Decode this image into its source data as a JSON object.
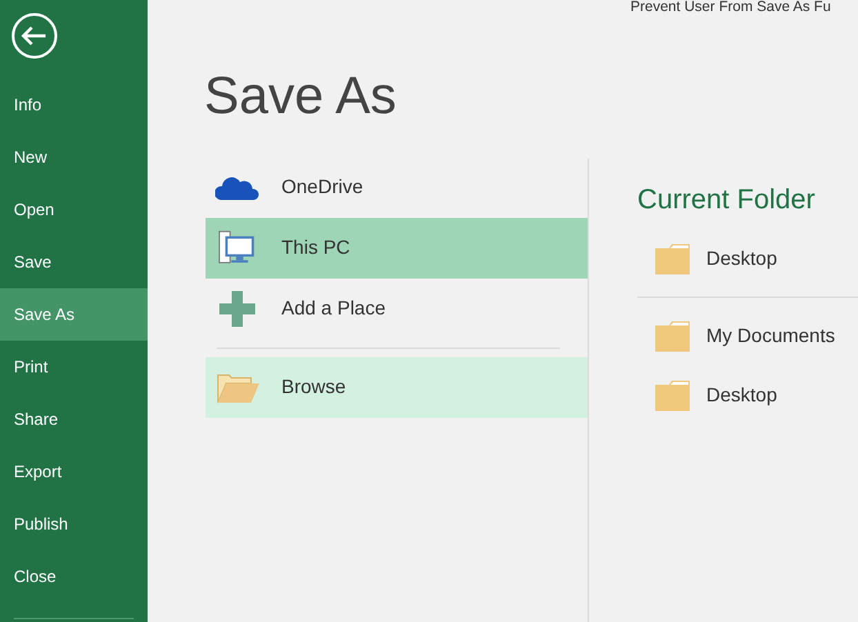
{
  "window": {
    "title": "Prevent User From Save As Fu"
  },
  "sidebar": {
    "items": [
      {
        "label": "Info",
        "selected": false
      },
      {
        "label": "New",
        "selected": false
      },
      {
        "label": "Open",
        "selected": false
      },
      {
        "label": "Save",
        "selected": false
      },
      {
        "label": "Save As",
        "selected": true
      },
      {
        "label": "Print",
        "selected": false
      },
      {
        "label": "Share",
        "selected": false
      },
      {
        "label": "Export",
        "selected": false
      },
      {
        "label": "Publish",
        "selected": false
      },
      {
        "label": "Close",
        "selected": false
      }
    ]
  },
  "heading": "Save As",
  "places": [
    {
      "kind": "cloud",
      "label": "OneDrive",
      "selected": false,
      "hovered": false
    },
    {
      "kind": "computer",
      "label": "This PC",
      "selected": true,
      "hovered": false
    },
    {
      "kind": "add",
      "label": "Add a Place",
      "selected": false,
      "hovered": false
    },
    {
      "kind": "folder",
      "label": "Browse",
      "selected": false,
      "hovered": true
    }
  ],
  "current_folder": {
    "title": "Current Folder",
    "folders": [
      {
        "label": "Desktop"
      }
    ]
  },
  "recent_folders": [
    {
      "label": "My Documents"
    },
    {
      "label": "Desktop"
    }
  ]
}
